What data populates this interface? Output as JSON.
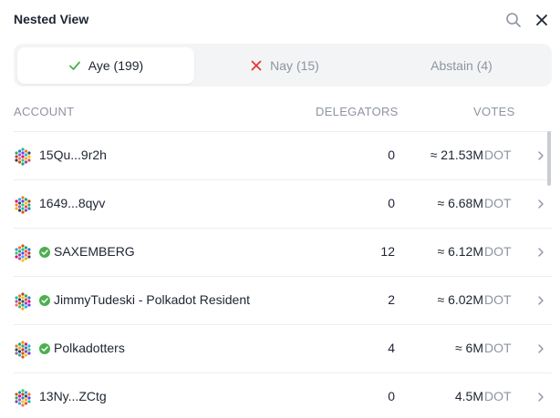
{
  "header": {
    "title": "Nested View",
    "search_icon": "search-icon",
    "close_icon": "close-icon"
  },
  "tabs": [
    {
      "label": "Aye (199)",
      "icon": "check-icon",
      "active": true,
      "icon_color": "#4caf50"
    },
    {
      "label": "Nay (15)",
      "icon": "x-icon",
      "active": false,
      "icon_color": "#e53935"
    },
    {
      "label": "Abstain (4)",
      "active": false
    }
  ],
  "columns": {
    "account": "ACCOUNT",
    "delegators": "DELEGATORS",
    "votes": "VOTES"
  },
  "rows": [
    {
      "name": "15Qu...9r2h",
      "verified": false,
      "delegators": "0",
      "votes": "≈ 21.53M",
      "unit": "DOT"
    },
    {
      "name": "1649...8qyv",
      "verified": false,
      "delegators": "0",
      "votes": "≈ 6.68M",
      "unit": "DOT"
    },
    {
      "name": "SAXEMBERG",
      "verified": true,
      "delegators": "12",
      "votes": "≈ 6.12M",
      "unit": "DOT"
    },
    {
      "name": "JimmyTudeski - Polkadot Resident",
      "verified": true,
      "delegators": "2",
      "votes": "≈ 6.02M",
      "unit": "DOT"
    },
    {
      "name": "Polkadotters",
      "verified": true,
      "delegators": "4",
      "votes": "≈ 6M",
      "unit": "DOT"
    },
    {
      "name": "13Ny...ZCtg",
      "verified": false,
      "delegators": "0",
      "votes": "4.5M",
      "unit": "DOT"
    }
  ],
  "colors": {
    "verified": "#4caf50",
    "muted": "#8d94a3"
  }
}
